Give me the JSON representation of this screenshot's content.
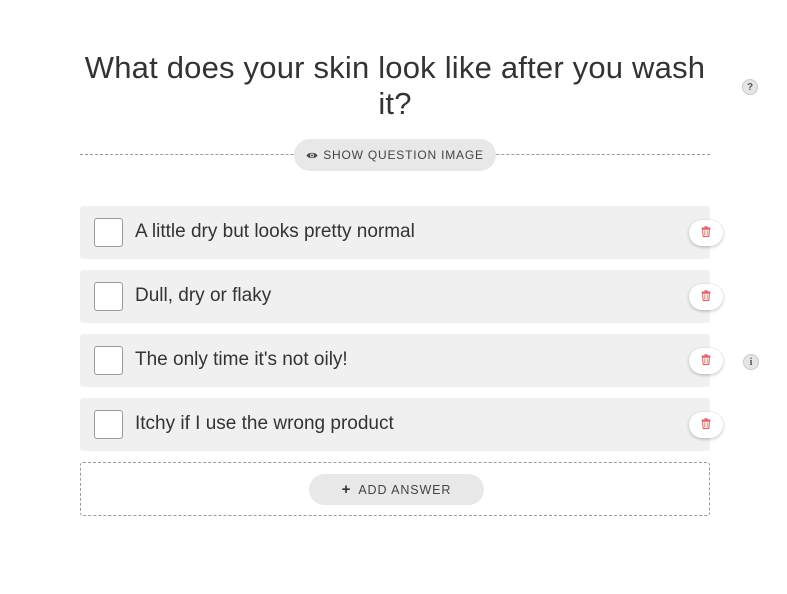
{
  "question": {
    "title": "What does your skin look like after you wash it?",
    "help_glyph": "?",
    "show_image_label": "SHOW QUESTION IMAGE",
    "show_image_icon": "eye-icon"
  },
  "answers": [
    {
      "label": "A little dry but looks pretty normal",
      "checked": false,
      "has_info": false
    },
    {
      "label": "Dull, dry or flaky",
      "checked": false,
      "has_info": false
    },
    {
      "label": "The only time it's not oily!",
      "checked": false,
      "has_info": true
    },
    {
      "label": "Itchy if I use the wrong product",
      "checked": false,
      "has_info": false
    }
  ],
  "info_glyph": "i",
  "add_answer": {
    "label": "ADD ANSWER",
    "icon": "+"
  },
  "colors": {
    "delete_icon": "#e05a5a",
    "row_background": "#f0f0f0",
    "pill_background": "#e8e8e8"
  }
}
